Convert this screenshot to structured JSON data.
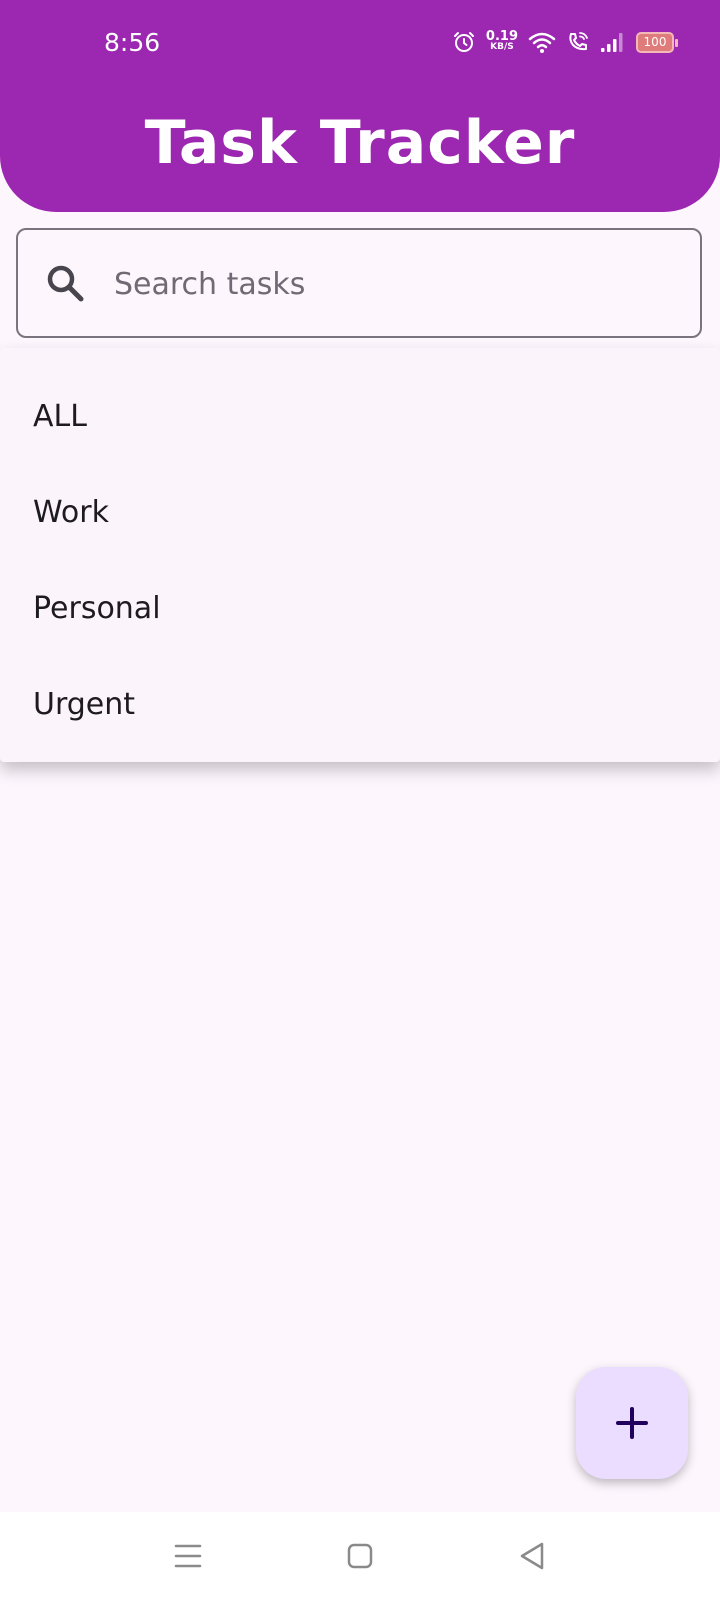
{
  "status_bar": {
    "time": "8:56",
    "net_speed_value": "0.19",
    "net_speed_unit": "KB/S",
    "battery": "100",
    "icons": [
      "alarm-icon",
      "wifi-icon",
      "wifi-calling-icon",
      "signal-icon",
      "battery-icon"
    ]
  },
  "header": {
    "title": "Task Tracker"
  },
  "search": {
    "placeholder": "Search tasks",
    "value": "",
    "icon": "search-icon"
  },
  "dropdown": {
    "items": [
      {
        "label": "ALL"
      },
      {
        "label": "Work"
      },
      {
        "label": "Personal"
      },
      {
        "label": "Urgent"
      }
    ]
  },
  "fab": {
    "icon": "plus-icon"
  },
  "nav_bar": {
    "icons": [
      "menu-icon",
      "home-icon",
      "back-icon"
    ]
  },
  "colors": {
    "primary": "#9C27B0",
    "background": "#FDF6FD",
    "fab": "#EADDFF",
    "fab_icon": "#21005D"
  }
}
